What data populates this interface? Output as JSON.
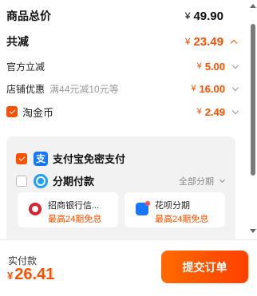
{
  "summary": {
    "total": {
      "label": "商品总价",
      "currency": "¥",
      "amount": "49.90"
    },
    "discount": {
      "label": "共减",
      "currency": "¥",
      "amount": "23.49"
    },
    "official": {
      "label": "官方立减",
      "currency": "¥",
      "amount": "5.00"
    },
    "shop": {
      "label": "店铺优惠",
      "hint": "满44元减10元等",
      "currency": "¥",
      "amount": "16.00"
    },
    "coin": {
      "label": "淘金币",
      "currency": "¥",
      "amount": "2.49",
      "checked": true
    }
  },
  "payment": {
    "alipay": {
      "label": "支付宝免密支付",
      "icon": "支",
      "checked": true
    },
    "installment": {
      "label": "分期付款",
      "all_label": "全部分期",
      "checked": false
    },
    "options": [
      {
        "name": "招商银行信...",
        "promo": "最高24期免息",
        "icon": "cmb-bank-icon"
      },
      {
        "name": "花呗分期",
        "promo": "最高24期免息",
        "icon": "huabei-icon"
      }
    ]
  },
  "footer": {
    "pay_label": "实付款",
    "currency": "¥",
    "amount": "26.41",
    "submit_label": "提交订单"
  },
  "colors": {
    "accent": "#ff5000",
    "alipay": "#1677ff",
    "panel": "#f2f2f2"
  }
}
